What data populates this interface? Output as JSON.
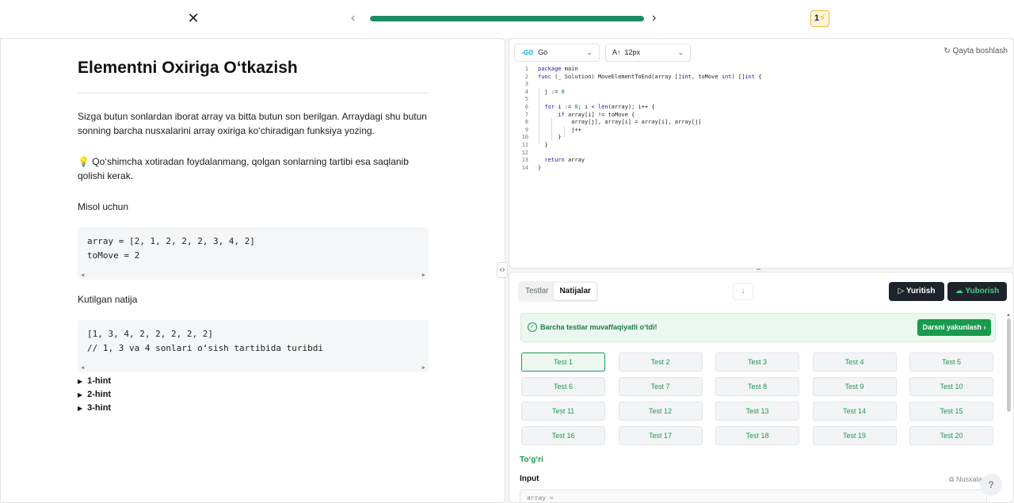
{
  "topbar": {
    "close_icon": "✕",
    "prev_icon": "‹",
    "next_icon": "›",
    "progress_fraction": 1.0,
    "streak_count": "1",
    "streak_icon": "⚡"
  },
  "problem": {
    "title": "Elementni Oxiriga O‘tkazish",
    "description": "Sizga butun sonlardan iborat array va bitta butun son berilgan. Arraydagi shu butun sonning barcha nusxalarini array oxiriga ko‘chiradigan funksiya yozing.",
    "note_icon": "💡",
    "note": "Qo‘shimcha xotiradan foydalanmang, qolgan sonlarning tartibi esa saqlanib qolishi kerak.",
    "example_heading": "Misol uchun",
    "example_code": "array = [2, 1, 2, 2, 2, 3, 4, 2]\ntoMove = 2",
    "expected_heading": "Kutilgan natija",
    "expected_code": "[1, 3, 4, 2, 2, 2, 2, 2]\n// 1, 3 va 4 sonlari o‘sish tartibida turibdi",
    "hints": [
      "1-hint",
      "2-hint",
      "3-hint"
    ]
  },
  "editor": {
    "language": "Go",
    "font_size": "12px",
    "reset_label": "Qayta boshlash",
    "line_numbers": [
      "1",
      "2",
      "3",
      "4",
      "5",
      "6",
      "7",
      "8",
      "9",
      "10",
      "11",
      "12",
      "13",
      "14"
    ],
    "code_lines": [
      "package main",
      "func (_ Solution) MoveElementToEnd(array []int, toMove int) []int {",
      "",
      "  j := 0",
      "",
      "  for i := 0; i < len(array); i++ {",
      "      if array[i] != toMove {",
      "          array[j], array[i] = array[i], array[j]",
      "          j++",
      "      }",
      "  }",
      "",
      "  return array",
      "}"
    ]
  },
  "results": {
    "tabs": [
      "Testlar",
      "Natijalar"
    ],
    "active_tab": "Natijalar",
    "run_label": "Yuritish",
    "submit_label": "Yuborish",
    "success_message": "Barcha testlar muvaffaqiyatli o‘tdi!",
    "finish_label": "Darsni yakunlash",
    "tests": [
      "Test 1",
      "Test 2",
      "Test 3",
      "Test 4",
      "Test 5",
      "Test 6",
      "Test 7",
      "Test 8",
      "Test 9",
      "Test 10",
      "Test 11",
      "Test 12",
      "Test 13",
      "Test 14",
      "Test 15",
      "Test 16",
      "Test 17",
      "Test 18",
      "Test 19",
      "Test 20"
    ],
    "verdict": "To‘g‘ri",
    "input_label": "Input",
    "copy_label": "Nusxalash",
    "input_preview": "array ="
  },
  "help_label": "?"
}
